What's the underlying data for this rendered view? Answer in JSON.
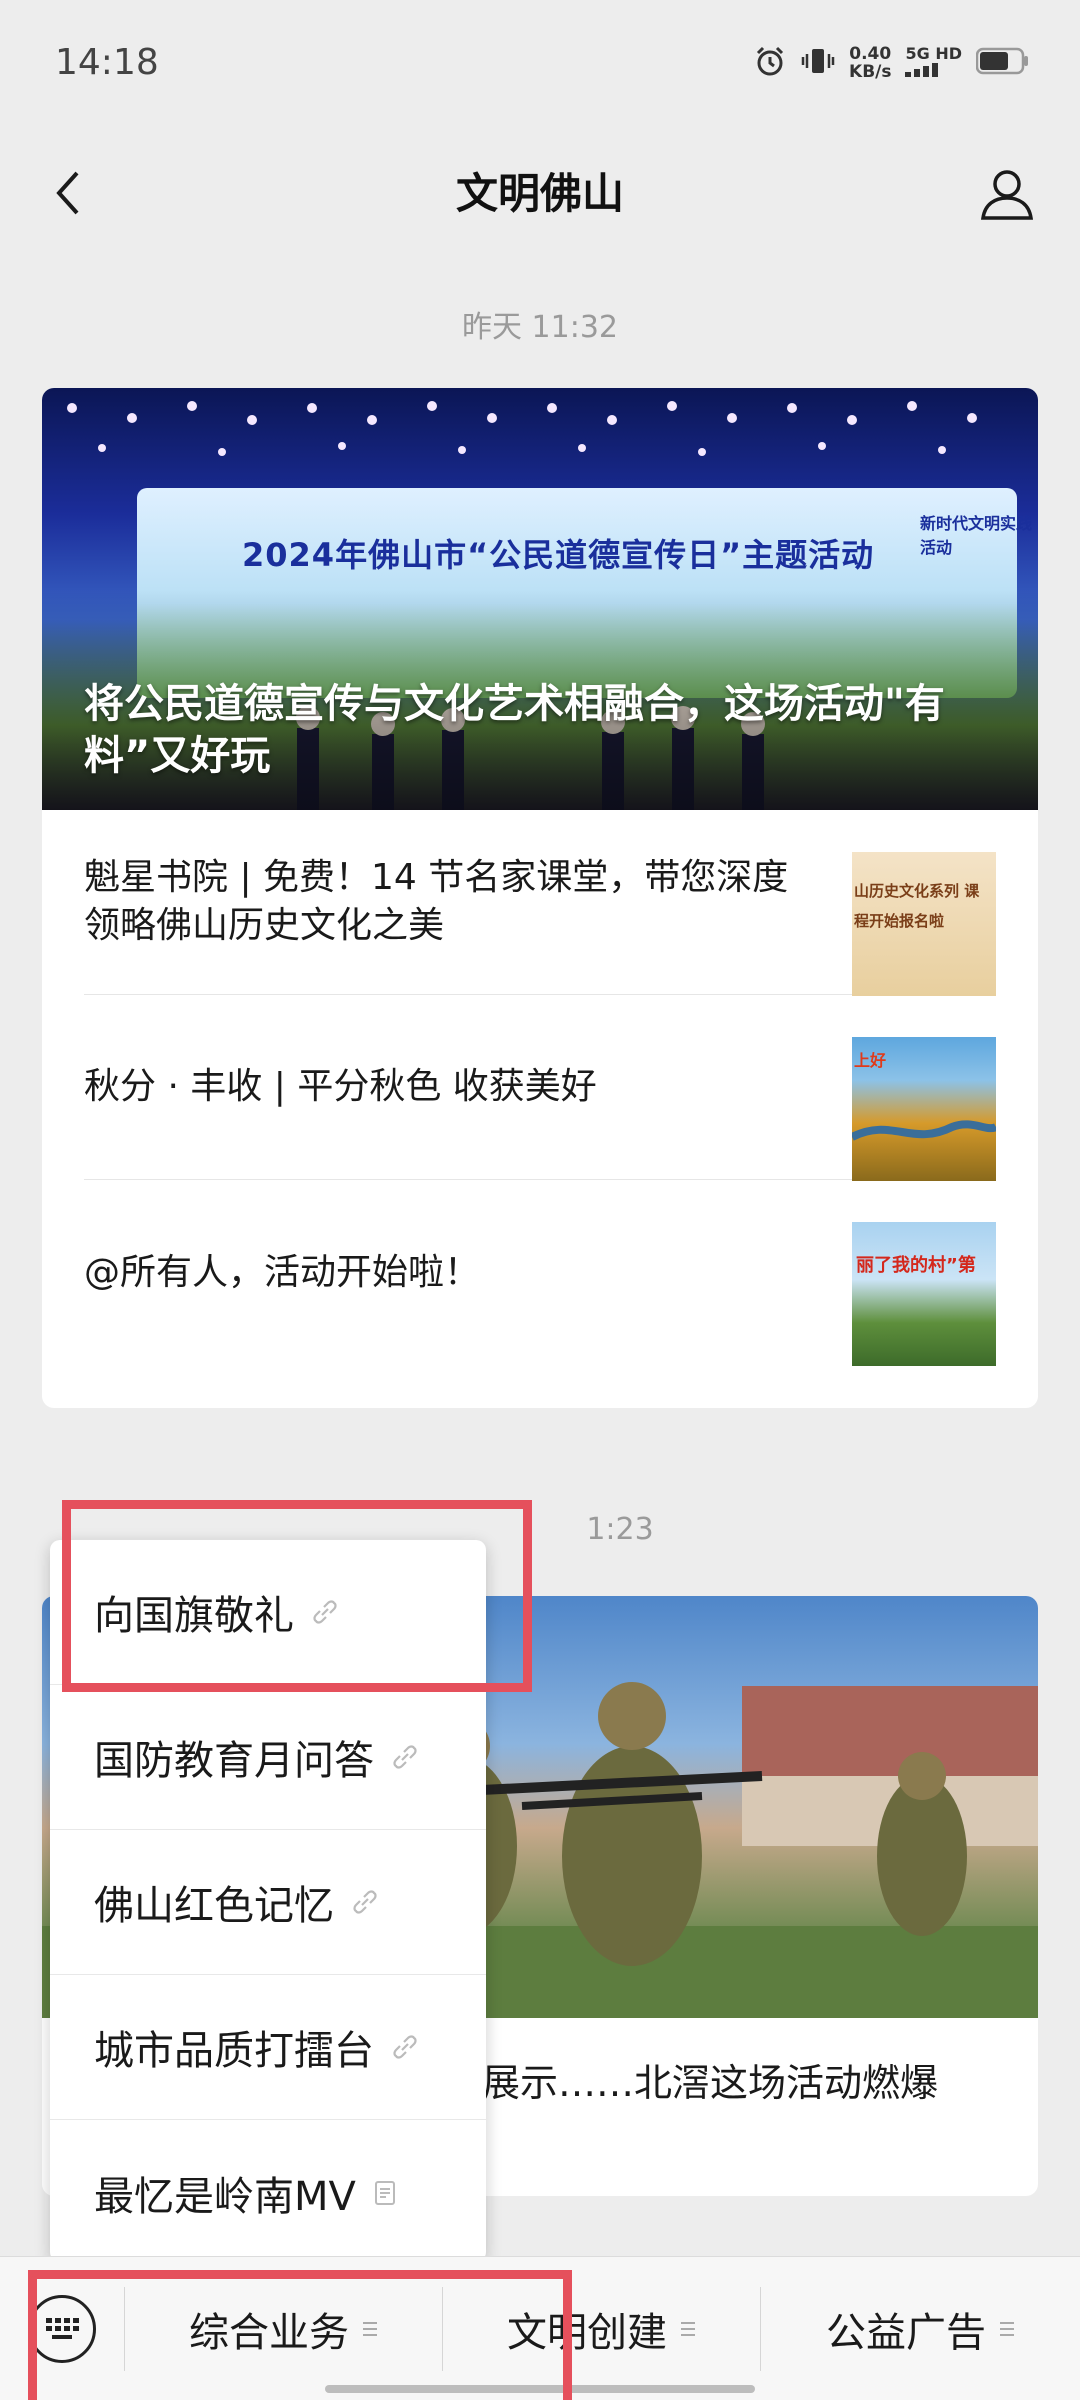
{
  "status_bar": {
    "time": "14:18",
    "speed_value": "0.40",
    "speed_unit": "KB/s",
    "network": "5G HD",
    "icons": [
      "alarm-icon",
      "vibrate-icon",
      "signal-icon",
      "battery-icon"
    ]
  },
  "nav": {
    "title": "文明佛山",
    "back_icon": "back-icon",
    "profile_icon": "profile-icon"
  },
  "feed": {
    "group1": {
      "timestamp": "昨天 11:32",
      "cover": {
        "banner_text": "2024年佛山市“公民道德宣传日”主题活动",
        "banner_tag": "新时代文明实践活动",
        "title": "将公民道德宣传与文化艺术相融合，这场活动\"有料”又好玩"
      },
      "items": [
        {
          "title": "魁星书院 | 免费！14 节名家课堂，带您深度领略佛山历史文化之美",
          "thumb_text": "山历史文化系列 课程开始报名啦"
        },
        {
          "title": "秋分 · 丰收 | 平分秋色 收获美好",
          "thumb_text": "上好"
        },
        {
          "title": "@所有人，活动开始啦！",
          "thumb_text": "丽了我的村”第"
        }
      ]
    },
    "group2": {
      "timestamp": "1:23",
      "title_visible": "展示……北滘这场活动燃爆"
    }
  },
  "popup_menu": {
    "items": [
      {
        "label": "向国旗敬礼",
        "icon": "link-icon"
      },
      {
        "label": "国防教育月问答",
        "icon": "link-icon"
      },
      {
        "label": "佛山红色记忆",
        "icon": "link-icon"
      },
      {
        "label": "城市品质打擂台",
        "icon": "link-icon"
      },
      {
        "label": "最忆是岭南MV",
        "icon": "article-icon"
      }
    ]
  },
  "bottom_menu": {
    "keyboard_icon": "keyboard-icon",
    "tabs": [
      "综合业务",
      "文明创建",
      "公益广告"
    ]
  },
  "colors": {
    "background": "#ededed",
    "highlight_box": "#e5505c"
  }
}
